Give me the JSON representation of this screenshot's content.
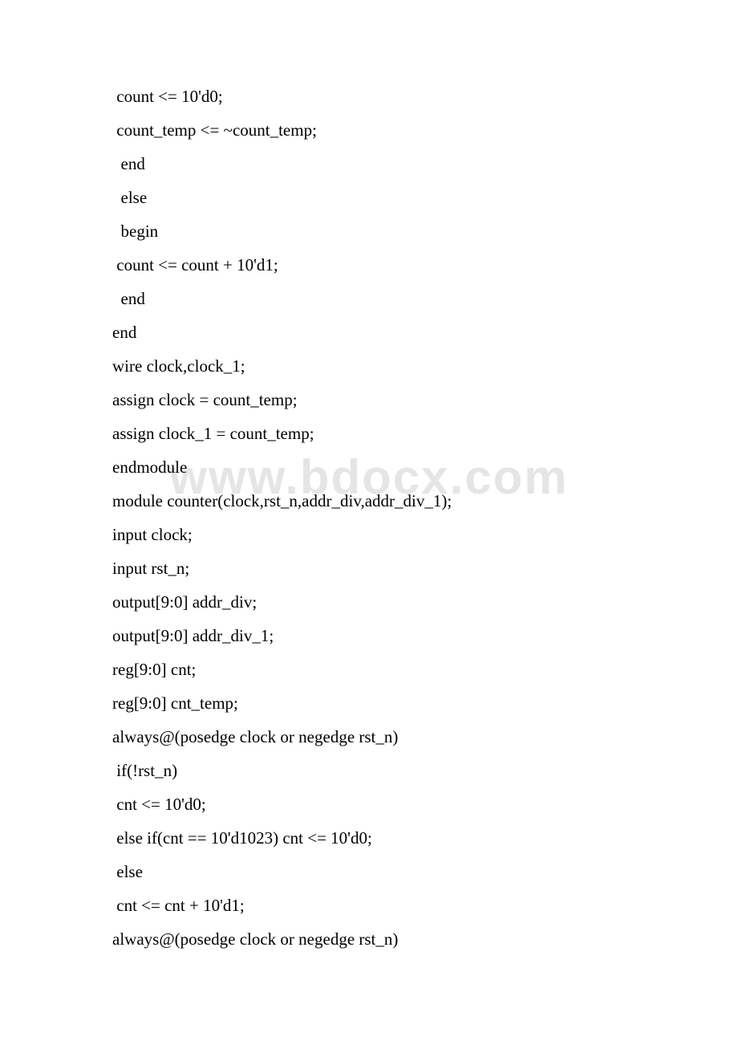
{
  "watermark": "www.bdocx.com",
  "lines": [
    " count <= 10'd0;",
    " count_temp <= ~count_temp;",
    "  end",
    "  else",
    "  begin",
    " count <= count + 10'd1;",
    "  end",
    "end",
    "wire clock,clock_1;",
    "assign clock = count_temp;",
    "assign clock_1 = count_temp;",
    "endmodule",
    "",
    "module counter(clock,rst_n,addr_div,addr_div_1);",
    "input clock;",
    "input rst_n;",
    "output[9:0] addr_div;",
    "output[9:0] addr_div_1;",
    "reg[9:0] cnt;",
    "reg[9:0] cnt_temp;",
    "always@(posedge clock or negedge rst_n)",
    " if(!rst_n)",
    " cnt <= 10'd0;",
    " else if(cnt == 10'd1023) cnt <= 10'd0;",
    " else",
    " cnt <= cnt + 10'd1;",
    "always@(posedge clock or negedge rst_n)"
  ]
}
